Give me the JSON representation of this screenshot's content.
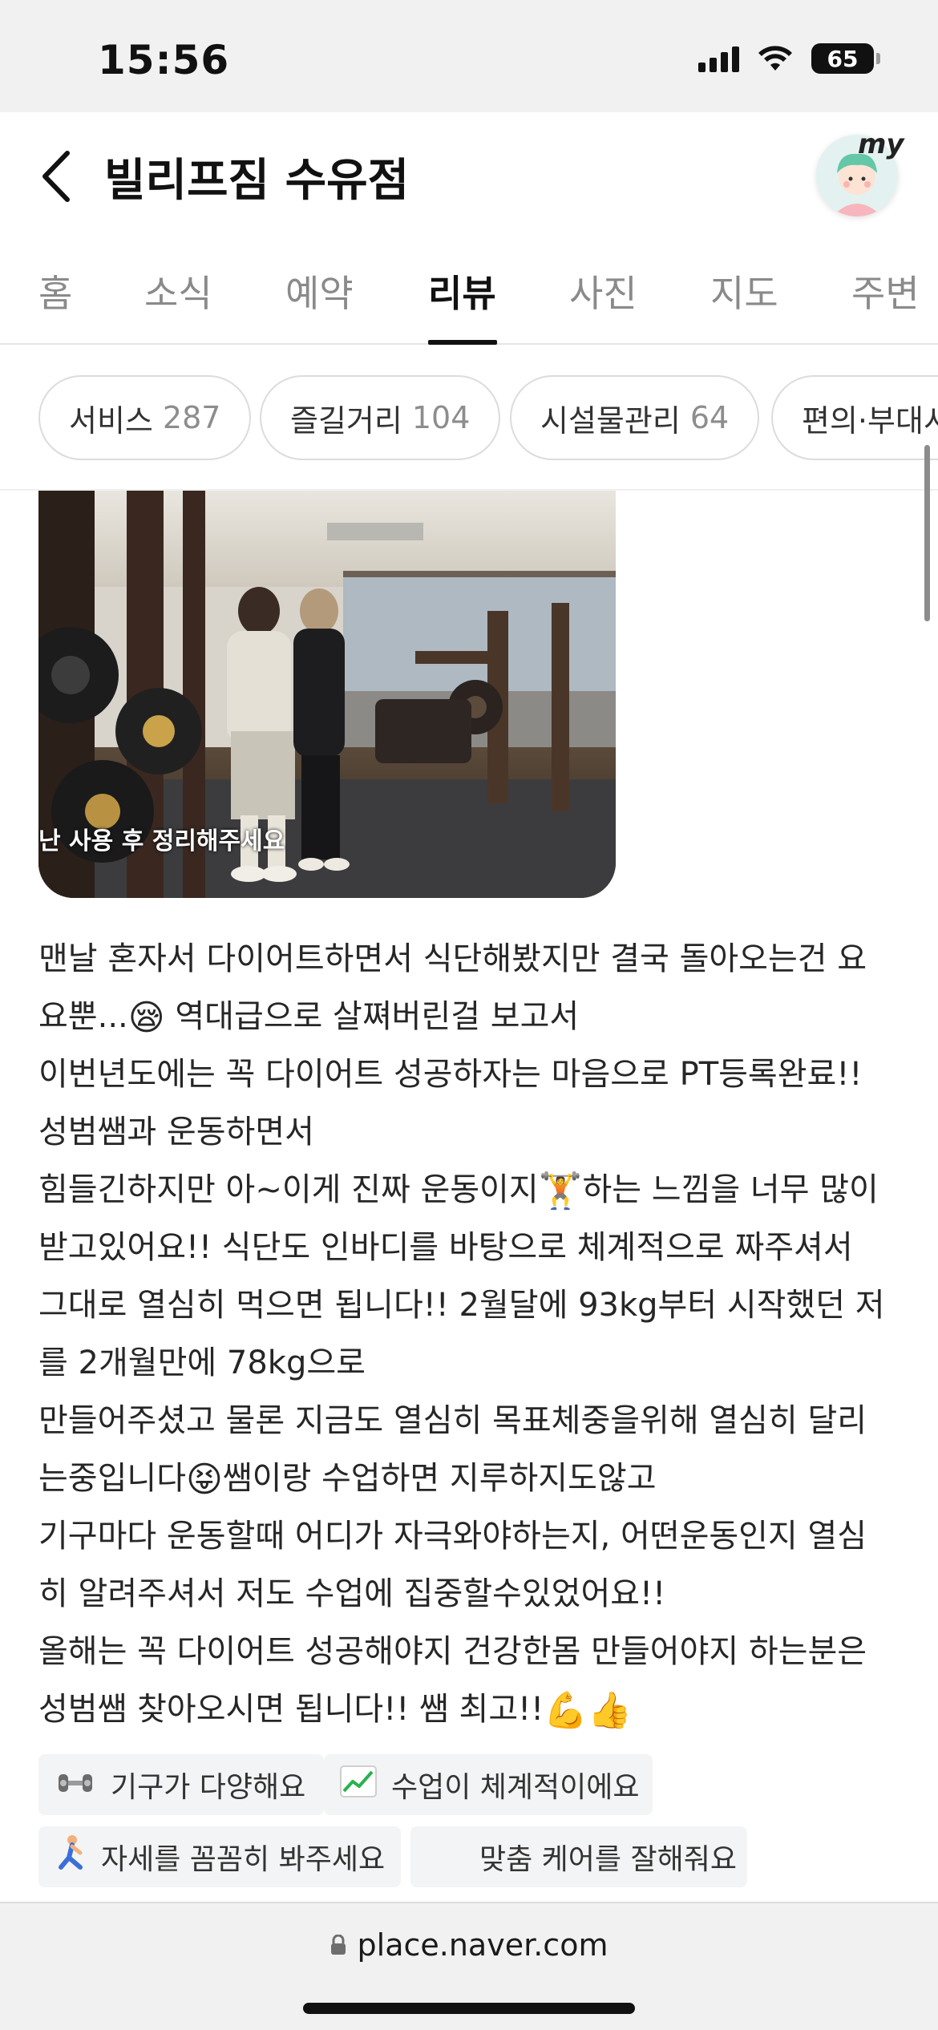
{
  "status_bar": {
    "time": "15:56",
    "battery": "65"
  },
  "header": {
    "title": "빌리프짐 수유점",
    "profile_label": "my"
  },
  "tabs": [
    {
      "label": "홈",
      "active": false
    },
    {
      "label": "소식",
      "active": false
    },
    {
      "label": "예약",
      "active": false
    },
    {
      "label": "리뷰",
      "active": true
    },
    {
      "label": "사진",
      "active": false
    },
    {
      "label": "지도",
      "active": false
    },
    {
      "label": "주변",
      "active": false
    }
  ],
  "filter_chips": [
    {
      "label": "서비스",
      "count": "287"
    },
    {
      "label": "즐길거리",
      "count": "104"
    },
    {
      "label": "시설물관리",
      "count": "64"
    },
    {
      "label": "편의·부대시",
      "count": ""
    }
  ],
  "review": {
    "photo_caption": "난 사용 후 정리해주세요",
    "lines": [
      "맨날 혼자서 다이어트하면서 식단해봤지만 결국 돌아오는건 요",
      "요뿐... 역대급으로 살쪄버린걸 보고서",
      "이번년도에는 꼭 다이어트 성공하자는 마음으로 PT등록완료!!",
      "성범쌤과 운동하면서",
      "힘들긴하지만 아~이게 진짜 운동이지 하는 느낌을 너무 많이",
      "받고있어요!! 식단도 인바디를 바탕으로 체계적으로 짜주셔서",
      "그대로 열심히 먹으면 됩니다!! 2월달에 93kg부터 시작했던 저",
      "를 2개월만에 78kg으로",
      "만들어주셨고 물론 지금도 열심히 목표체중을위해 열심히 달리",
      "는중입니다 쌤이랑 수업하면 지루하지도않고",
      "기구마다 운동할때 어디가 자극와야하는지, 어떤운동인지 열심",
      "히 알려주셔서 저도 수업에 집중할수있었어요!!",
      "올해는 꼭 다이어트 성공해야지 건강한몸 만들어야지 하는분은",
      "성범쌤 찾아오시면 됩니다!! 쌤 최고!!"
    ],
    "line_parts": {
      "l2a": "요뿐...",
      "l2b": " 역대급으로 살쪄버린걸 보고서",
      "l5a": "힘들긴하지만 아~이게 진짜 운동이지",
      "l5b": "하는 느낌을 너무 많이",
      "l10a": "는중입니다",
      "l10b": "쌤이랑 수업하면 지루하지도않고",
      "l14a": "성범쌤 찾아오시면 됩니다!! 쌤 최고!!"
    }
  },
  "keywords": [
    {
      "icon": "dumbbell-icon",
      "label": "기구가 다양해요"
    },
    {
      "icon": "chart-up-icon",
      "label": "수업이 체계적이에요"
    },
    {
      "icon": "stretching-person-icon",
      "label": "자세를 꼼꼼히 봐주세요"
    },
    {
      "icon": "",
      "label": "맞춤 케어를 잘해줘요"
    }
  ],
  "browser": {
    "url": "place.naver.com"
  }
}
